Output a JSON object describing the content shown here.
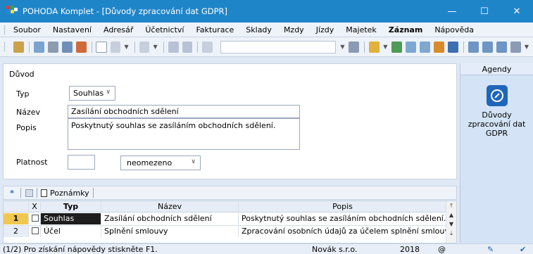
{
  "window": {
    "title": "POHODA Komplet - [Důvody zpracování dat GDPR]",
    "controls": {
      "minimize": "—",
      "maximize": "☐",
      "close": "✕"
    }
  },
  "menu": [
    "Soubor",
    "Nastavení",
    "Adresář",
    "Účetnictví",
    "Fakturace",
    "Sklady",
    "Mzdy",
    "Jízdy",
    "Majetek",
    "Záznam",
    "Nápověda"
  ],
  "menu_bold_index": 9,
  "toolbar": {
    "combo_value": "",
    "icons": [
      "filter-icon",
      "preview-icon",
      "print-icon",
      "report-icon",
      "refresh-icon",
      "new-record-icon",
      "edit-icon",
      "back-icon",
      "save-icon",
      "save-all-icon",
      "copy-icon",
      "clear-filter-icon",
      "folder-icon",
      "settings-icon",
      "table-icon",
      "grid-icon",
      "users-icon",
      "ban-icon",
      "window-icon",
      "window2-icon",
      "window3-icon",
      "tools-icon"
    ]
  },
  "form": {
    "group_label": "Důvod",
    "typ_label": "Typ",
    "typ_value": "Souhlas",
    "nazev_label": "Název",
    "nazev_value": "Zasílání obchodních sdělení",
    "popis_label": "Popis",
    "popis_value": "Poskytnutý souhlas se zasíláním obchodních sdělení.",
    "platnost_label": "Platnost",
    "platnost_value": "",
    "platnost_select": "neomezeno"
  },
  "grid": {
    "tabs": {
      "star": "*",
      "notes": "Poznámky"
    },
    "headers": {
      "x": "X",
      "typ": "Typ",
      "nazev": "Název",
      "popis": "Popis"
    },
    "rows": [
      {
        "num": "1",
        "typ": "Souhlas",
        "nazev": "Zasílání obchodních sdělení",
        "popis": "Poskytnutý souhlas se zasíláním obchodních sdělení."
      },
      {
        "num": "2",
        "typ": "Účel",
        "nazev": "Splnění smlouvy",
        "popis": "Zpracování osobních údajů za účelem splnění smlouvy."
      }
    ]
  },
  "agendy": {
    "header": "Agendy",
    "item_label": "Důvody zpracování dat GDPR"
  },
  "status": {
    "left": "(1/2) Pro získání nápovědy stiskněte F1.",
    "company": "Novák s.r.o.",
    "year": "2018",
    "at": "@"
  },
  "colors": {
    "titlebar": "#1f85c9",
    "selected_row": "#1d1d1d",
    "row_number_active": "#f0c850",
    "app_icon": [
      "#e53935",
      "#43a047",
      "#1e88e5",
      "#fdd835"
    ]
  }
}
